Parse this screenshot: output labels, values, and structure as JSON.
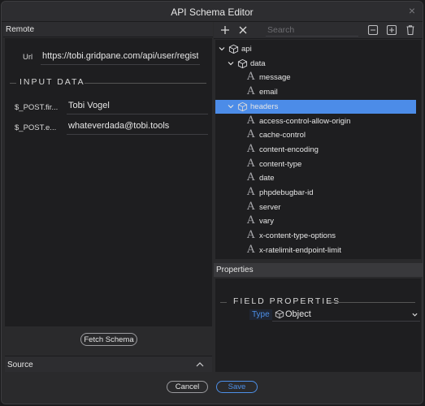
{
  "window": {
    "title": "API Schema Editor"
  },
  "left": {
    "remote_header": "Remote",
    "url": {
      "label": "Url",
      "value": "https://tobi.gridpane.com/api/user/regist"
    },
    "input_data_title": "INPUT DATA",
    "post_fields": [
      {
        "label": "$_POST.fir...",
        "value": "Tobi Vogel"
      },
      {
        "label": "$_POST.e...",
        "value": "whateverdada@tobi.tools"
      }
    ],
    "fetch_label": "Fetch Schema",
    "source_header": "Source"
  },
  "right": {
    "search_placeholder": "Search",
    "tree": [
      {
        "label": "api",
        "type": "object",
        "level": 0,
        "expanded": true
      },
      {
        "label": "data",
        "type": "object",
        "level": 1,
        "expanded": true
      },
      {
        "label": "message",
        "type": "text",
        "level": 2
      },
      {
        "label": "email",
        "type": "text",
        "level": 2
      },
      {
        "label": "headers",
        "type": "object",
        "level": 1,
        "expanded": true,
        "selected": true
      },
      {
        "label": "access-control-allow-origin",
        "type": "text",
        "level": 2
      },
      {
        "label": "cache-control",
        "type": "text",
        "level": 2
      },
      {
        "label": "content-encoding",
        "type": "text",
        "level": 2
      },
      {
        "label": "content-type",
        "type": "text",
        "level": 2
      },
      {
        "label": "date",
        "type": "text",
        "level": 2
      },
      {
        "label": "phpdebugbar-id",
        "type": "text",
        "level": 2
      },
      {
        "label": "server",
        "type": "text",
        "level": 2
      },
      {
        "label": "vary",
        "type": "text",
        "level": 2
      },
      {
        "label": "x-content-type-options",
        "type": "text",
        "level": 2
      },
      {
        "label": "x-ratelimit-endpoint-limit",
        "type": "text",
        "level": 2
      }
    ],
    "properties_header": "Properties",
    "field_properties_title": "FIELD PROPERTIES",
    "type_label": "Type",
    "type_value": "Object"
  },
  "footer": {
    "cancel_label": "Cancel",
    "save_label": "Save"
  },
  "colors": {
    "accent": "#4d8fe8",
    "selection": "#4c8ce8"
  }
}
